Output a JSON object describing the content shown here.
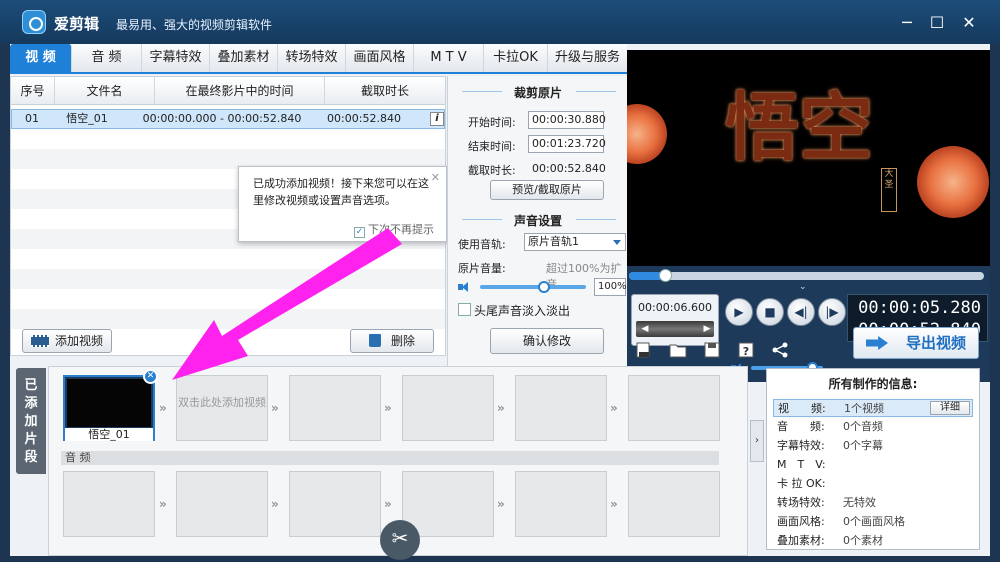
{
  "app": {
    "title": "爱剪辑",
    "subtitle": "最易用、强大的视频剪辑软件",
    "window_controls": [
      "minimize-icon",
      "maximize-icon",
      "close-icon"
    ]
  },
  "tabs": [
    {
      "label": "视 频",
      "active": true
    },
    {
      "label": "音 频"
    },
    {
      "label": "字幕特效"
    },
    {
      "label": "叠加素材"
    },
    {
      "label": "转场特效"
    },
    {
      "label": "画面风格"
    },
    {
      "label": "M T V"
    },
    {
      "label": "卡拉OK"
    },
    {
      "label": "升级与服务"
    }
  ],
  "file_list": {
    "columns": [
      "序号",
      "文件名",
      "在最终影片中的时间",
      "截取时长"
    ],
    "rows": [
      {
        "index": "01",
        "name": "悟空_01",
        "range": "00:00:00.000 - 00:00:52.840",
        "duration": "00:00:52.840"
      }
    ]
  },
  "tooltip": {
    "message": "已成功添加视频！接下来您可以在这里修改视频或设置声音选项。",
    "dont_show": "下次不再提示",
    "checked": true
  },
  "buttons": {
    "add_video": "添加视频",
    "delete": "删除",
    "preview_crop": "预览/截取原片",
    "confirm": "确认修改"
  },
  "crop": {
    "title": "裁剪原片",
    "start_label": "开始时间:",
    "start_value": "00:00:30.880",
    "end_label": "结束时间:",
    "end_value": "00:01:23.720",
    "duration_label": "截取时长:",
    "duration_value": "00:00:52.840"
  },
  "sound": {
    "title": "声音设置",
    "track_label": "使用音轨:",
    "track_value": "原片音轨1",
    "volume_label": "原片音量:",
    "volume_hint": "超过100%为扩音",
    "volume_value": "100%",
    "volume_level": 0.6,
    "fade_label": "头尾声音淡入淡出",
    "fade_checked": false
  },
  "preview": {
    "calligraphy": "悟空",
    "seal_text": "大圣",
    "progress": 0.1
  },
  "playback": {
    "current_time": "00:00:06.600",
    "time_top": "00:00:05.280",
    "time_bottom": "00:00:52.840",
    "volume_level": 0.85,
    "controls": [
      "play-icon",
      "stop-icon",
      "prev-frame-icon",
      "next-frame-icon"
    ]
  },
  "toolbar_icons": [
    "new-icon",
    "open-folder-icon",
    "save-icon",
    "help-icon",
    "share-icon"
  ],
  "export": {
    "label": "导出视频"
  },
  "timeline": {
    "side_label": [
      "已",
      "添",
      "加",
      "片",
      "段"
    ],
    "clip_name": "悟空_01",
    "empty_hint": "双击此处添加视频",
    "audio_label": "音 频"
  },
  "info_panel": {
    "title": "所有制作的信息:",
    "detail_button": "详细",
    "rows": [
      {
        "key": "视　　频:",
        "value": "1个视频",
        "selected": true
      },
      {
        "key": "音　　频:",
        "value": "0个音频"
      },
      {
        "key": "字幕特效:",
        "value": "0个字幕"
      },
      {
        "key": "M　T　V:",
        "value": ""
      },
      {
        "key": "卡 拉 OK:",
        "value": ""
      },
      {
        "key": "转场特效:",
        "value": "无特效"
      },
      {
        "key": "画面风格:",
        "value": "0个画面风格"
      },
      {
        "key": "叠加素材:",
        "value": "0个素材"
      }
    ]
  },
  "colors": {
    "accent": "#1f80d8",
    "annotation": "#ff22ee",
    "title_bar": "#1c4d7a"
  }
}
